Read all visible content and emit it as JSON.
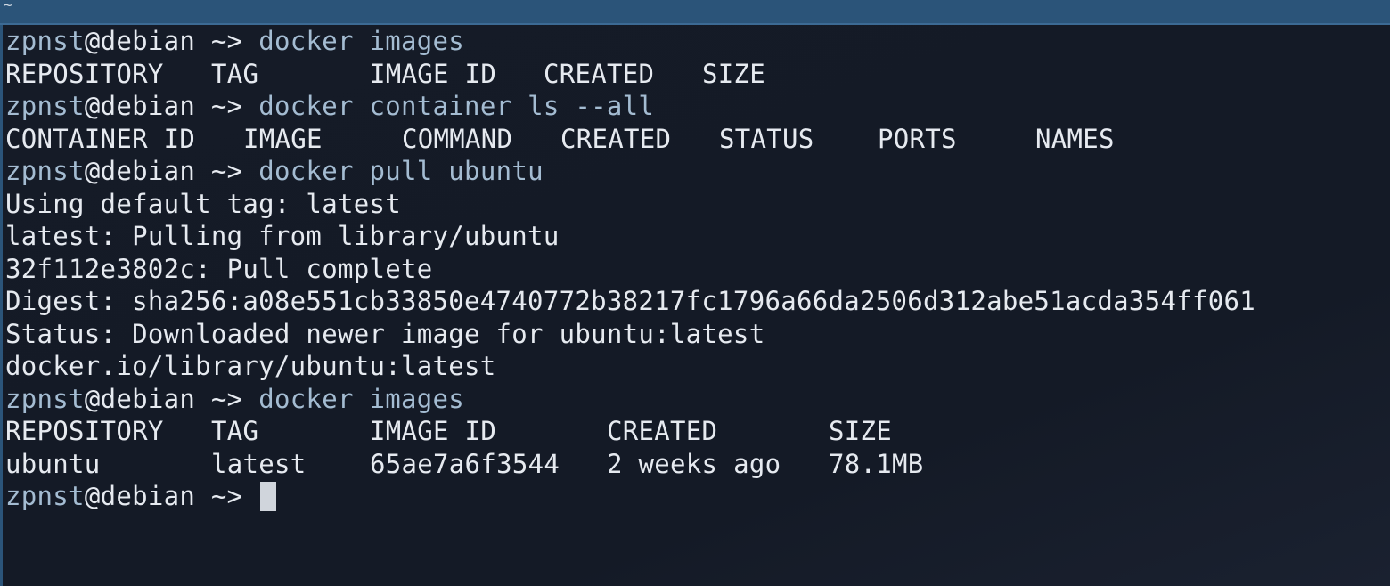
{
  "titlebar": {
    "title": "~"
  },
  "prompt": {
    "user": "zpnst",
    "at": "@",
    "host": "debian",
    "path": " ~> "
  },
  "commands": {
    "c1": "docker images",
    "c2": "docker container ls --all",
    "c3": "docker pull ubuntu",
    "c4": "docker images"
  },
  "images_table_1": {
    "headers": [
      "REPOSITORY",
      "TAG",
      "IMAGE ID",
      "CREATED",
      "SIZE"
    ]
  },
  "containers_table": {
    "headers": [
      "CONTAINER ID",
      "IMAGE",
      "COMMAND",
      "CREATED",
      "STATUS",
      "PORTS",
      "NAMES"
    ]
  },
  "pull_output": [
    "Using default tag: latest",
    "latest: Pulling from library/ubuntu",
    "32f112e3802c: Pull complete",
    "Digest: sha256:a08e551cb33850e4740772b38217fc1796a66da2506d312abe51acda354ff061",
    "Status: Downloaded newer image for ubuntu:latest",
    "docker.io/library/ubuntu:latest"
  ],
  "images_table_2": {
    "headers": [
      "REPOSITORY",
      "TAG",
      "IMAGE ID",
      "CREATED",
      "SIZE"
    ],
    "rows": [
      [
        "ubuntu",
        "latest",
        "65ae7a6f3544",
        "2 weeks ago",
        "78.1MB"
      ]
    ]
  }
}
